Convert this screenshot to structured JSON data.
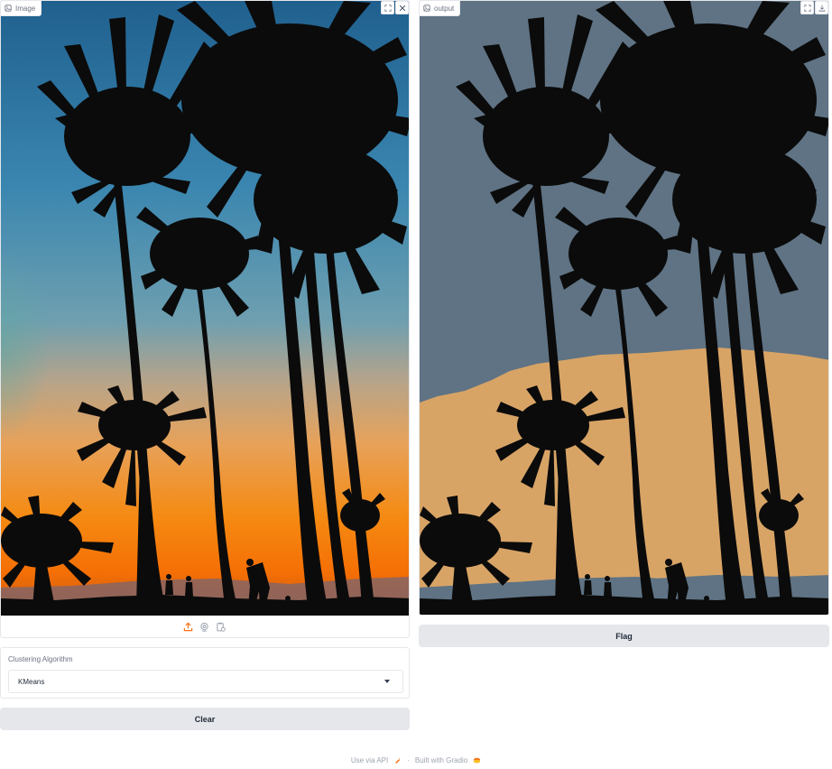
{
  "input_panel": {
    "label": "Image",
    "label_icon": "image-icon",
    "corner_icons": [
      "fullscreen-icon",
      "close-icon"
    ],
    "upload_toolbar": [
      "upload-icon",
      "webcam-icon",
      "clipboard-icon"
    ]
  },
  "output_panel": {
    "label": "output",
    "label_icon": "image-icon",
    "corner_icons": [
      "fullscreen-icon",
      "download-icon"
    ]
  },
  "clustering": {
    "label": "Clustering Algorithm",
    "selected": "KMeans"
  },
  "buttons": {
    "clear": "Clear",
    "flag": "Flag"
  },
  "footer": {
    "api": "Use via API",
    "separator": "·",
    "built_with": "Built with Gradio"
  },
  "colors": {
    "accent_orange": "#f97316",
    "button_bg": "#e5e7eb",
    "sky_top": "#2d6f96",
    "sunset_orange": "#f5860f",
    "segment_gray": "#5f7384",
    "segment_tan": "#d8a466",
    "silhouette": "#0b0b0b"
  }
}
